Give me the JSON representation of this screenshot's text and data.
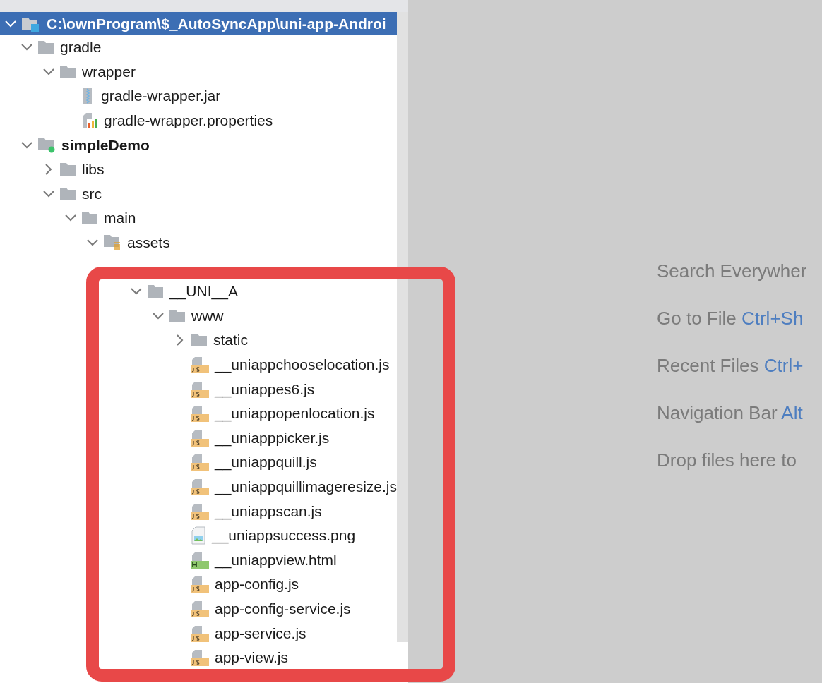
{
  "tree": {
    "nodes": [
      {
        "label": "C:\\ownProgram\\$_AutoSyncApp\\uni-app-Androi",
        "kind": "project",
        "expanded": true,
        "selected": true,
        "children": [
          {
            "label": "gradle",
            "kind": "folder",
            "expanded": true,
            "selected": false,
            "children": [
              {
                "label": "wrapper",
                "kind": "folder",
                "expanded": true,
                "selected": false,
                "children": [
                  {
                    "label": "gradle-wrapper.jar",
                    "kind": "jar",
                    "selected": false
                  },
                  {
                    "label": "gradle-wrapper.properties",
                    "kind": "properties",
                    "selected": false
                  }
                ]
              }
            ]
          },
          {
            "label": "simpleDemo",
            "kind": "module",
            "expanded": true,
            "selected": false,
            "children": [
              {
                "label": "libs",
                "kind": "folder",
                "expanded": false,
                "selected": false
              },
              {
                "label": "src",
                "kind": "folder",
                "expanded": true,
                "selected": false,
                "children": [
                  {
                    "label": "main",
                    "kind": "folder",
                    "expanded": true,
                    "selected": false,
                    "children": [
                      {
                        "label": "assets",
                        "kind": "assets",
                        "expanded": true,
                        "selected": false,
                        "children": [
                          {
                            "expanded": true,
                            "selected": false,
                            "children": [
                              {
                                "label": "__UNI__A",
                                "kind": "folder",
                                "expanded": true,
                                "selected": false,
                                "children": [
                                  {
                                    "label": "www",
                                    "kind": "folder",
                                    "expanded": true,
                                    "selected": false,
                                    "children": [
                                      {
                                        "label": "static",
                                        "kind": "folder",
                                        "expanded": false,
                                        "selected": false
                                      },
                                      {
                                        "label": "__uniappchooselocation.js",
                                        "kind": "js",
                                        "selected": false
                                      },
                                      {
                                        "label": "__uniappes6.js",
                                        "kind": "js",
                                        "selected": false
                                      },
                                      {
                                        "label": "__uniappopenlocation.js",
                                        "kind": "js",
                                        "selected": false
                                      },
                                      {
                                        "label": "__uniapppicker.js",
                                        "kind": "js",
                                        "selected": false
                                      },
                                      {
                                        "label": "__uniappquill.js",
                                        "kind": "js",
                                        "selected": false
                                      },
                                      {
                                        "label": "__uniappquillimageresize.js",
                                        "kind": "js",
                                        "selected": false
                                      },
                                      {
                                        "label": "__uniappscan.js",
                                        "kind": "js",
                                        "selected": false
                                      },
                                      {
                                        "label": "__uniappsuccess.png",
                                        "kind": "png",
                                        "selected": false
                                      },
                                      {
                                        "label": "__uniappview.html",
                                        "kind": "html",
                                        "selected": false
                                      },
                                      {
                                        "label": "app-config.js",
                                        "kind": "js",
                                        "selected": false
                                      },
                                      {
                                        "label": "app-config-service.js",
                                        "kind": "js",
                                        "selected": false
                                      },
                                      {
                                        "label": "app-service.js",
                                        "kind": "js",
                                        "selected": false
                                      },
                                      {
                                        "label": "app-view.js",
                                        "kind": "js",
                                        "selected": false
                                      }
                                    ]
                                  }
                                ]
                              }
                            ]
                          }
                        ]
                      }
                    ]
                  }
                ]
              }
            ]
          }
        ]
      }
    ]
  },
  "welcome": {
    "actions": [
      {
        "label": "Search Everywher"
      },
      {
        "label": "Go to File",
        "shortcut": "Ctrl+Sh"
      },
      {
        "label": "Recent Files",
        "shortcut": "Ctrl+"
      },
      {
        "label": "Navigation Bar",
        "shortcut": "Alt"
      },
      {
        "label": "Drop files here to"
      }
    ]
  }
}
